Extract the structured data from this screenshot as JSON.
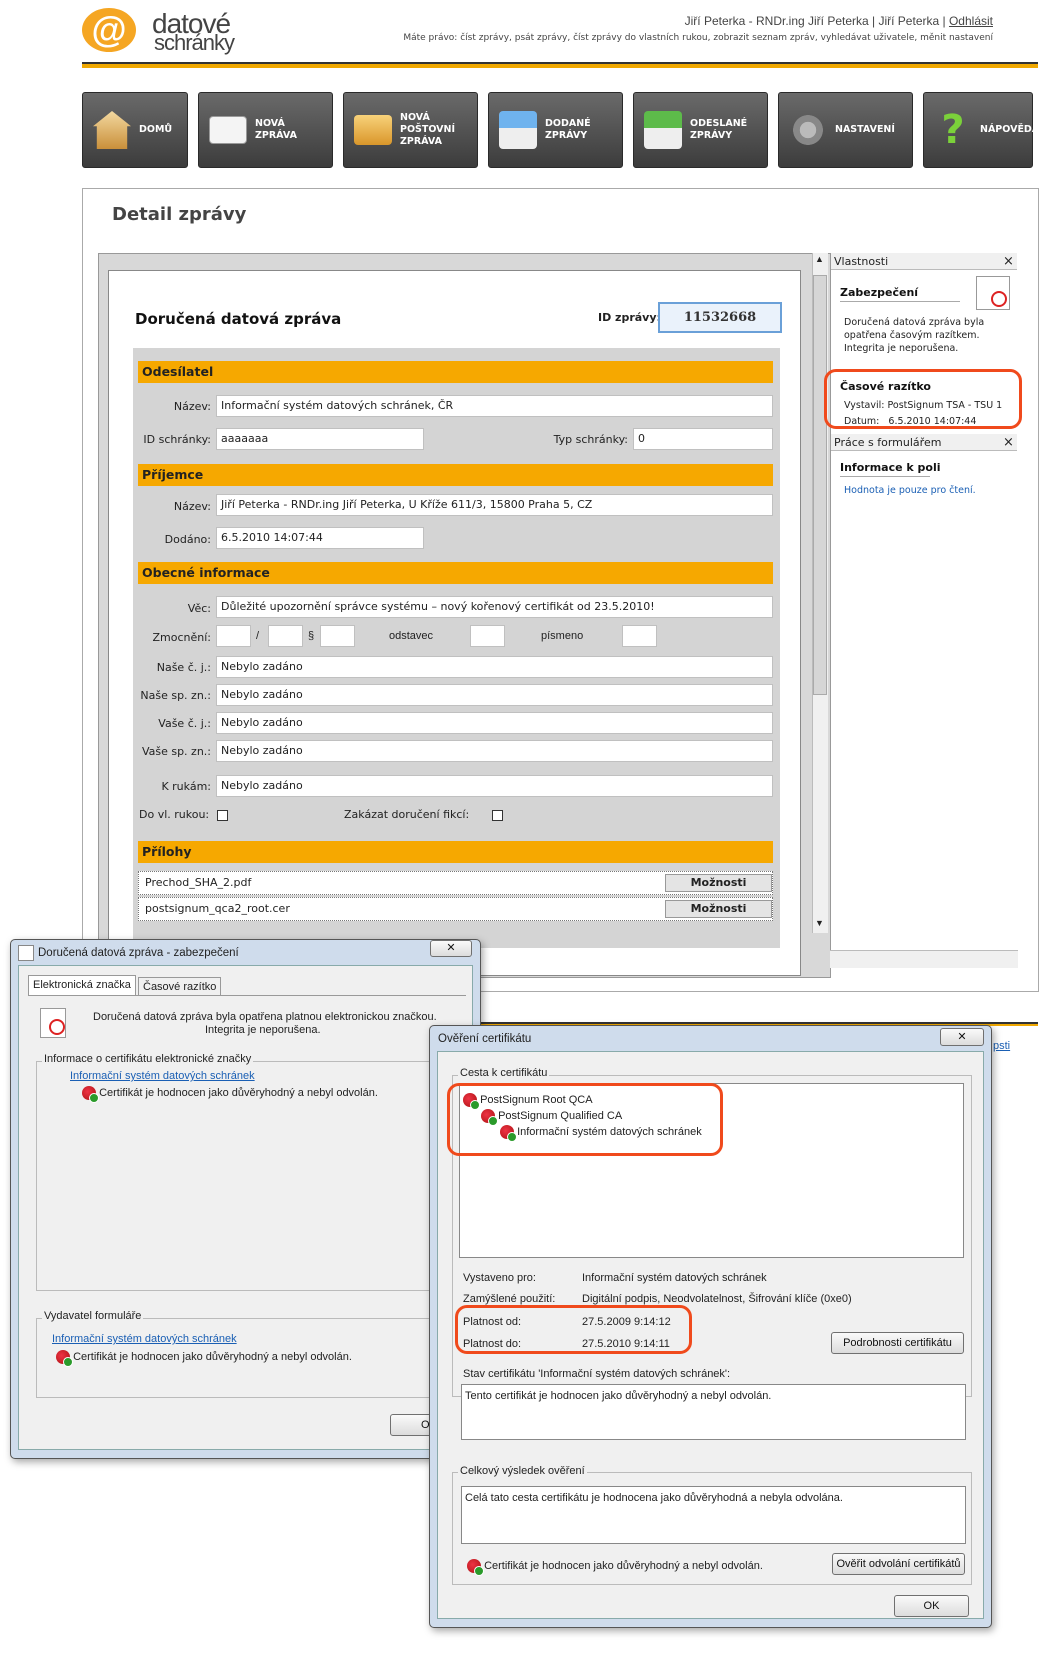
{
  "header": {
    "logo_at": "@",
    "logo_line1": "datové",
    "logo_line2": "schránky",
    "user_text": "Jiří Peterka - RNDr.ing Jiří Peterka | Jiří Peterka |",
    "logout": "Odhlásit",
    "rights": "Máte právo: číst zprávy, psát zprávy, číst zprávy do vlastních rukou, zobrazit seznam zpráv, vyhledávat uživatele, měnit nastavení"
  },
  "nav": [
    {
      "l1": "DOMŮ",
      "l2": "",
      "l3": "",
      "icon": "home-icon"
    },
    {
      "l1": "NOVÁ",
      "l2": "ZPRÁVA",
      "l3": "",
      "icon": "envelope-icon"
    },
    {
      "l1": "NOVÁ",
      "l2": "POŠTOVNÍ",
      "l3": "ZPRÁVA",
      "icon": "money-envelope-icon"
    },
    {
      "l1": "DODANÉ",
      "l2": "ZPRÁVY",
      "l3": "",
      "icon": "inbox-icon"
    },
    {
      "l1": "ODESLANÉ",
      "l2": "ZPRÁVY",
      "l3": "",
      "icon": "outbox-icon"
    },
    {
      "l1": "NASTAVENÍ",
      "l2": "",
      "l3": "",
      "icon": "gears-icon"
    },
    {
      "l1": "NÁPOVĚDA",
      "l2": "",
      "l3": "",
      "icon": "question-icon"
    }
  ],
  "page_title": "Detail zprávy",
  "message": {
    "title": "Doručená datová zpráva",
    "id_label": "ID zprávy:",
    "id_value": "11532668",
    "sections": {
      "sender": "Odesílatel",
      "recipient": "Příjemce",
      "general": "Obecné informace",
      "attachments": "Přílohy"
    },
    "sender": {
      "name_label": "Název:",
      "name_value": "Informační systém datových schránek, ČR",
      "box_label": "ID schránky:",
      "box_value": "aaaaaaa",
      "type_label": "Typ schránky:",
      "type_value": "0"
    },
    "recipient": {
      "name_label": "Název:",
      "name_value": "Jiří Peterka - RNDr.ing Jiří Peterka, U Kříže 611/3, 15800 Praha 5, CZ",
      "delivered_label": "Dodáno:",
      "delivered_value": "6.5.2010 14:07:44"
    },
    "general": {
      "subject_label": "Věc:",
      "subject_value": "Důležité upozornění správce systému – nový kořenový certifikát od 23.5.2010!",
      "auth_label": "Zmocnění:",
      "slash": "/",
      "paragraph": "§",
      "odstavec": "odstavec",
      "pismeno": "písmeno",
      "our_ref_label": "Naše č. j.:",
      "our_ref_value": "Nebylo zadáno",
      "our_file_label": "Naše sp. zn.:",
      "our_file_value": "Nebylo zadáno",
      "your_ref_label": "Vaše č. j.:",
      "your_ref_value": "Nebylo zadáno",
      "your_file_label": "Vaše sp. zn.:",
      "your_file_value": "Nebylo zadáno",
      "to_hands_label": "K rukám:",
      "to_hands_value": "Nebylo zadáno",
      "personal_label": "Do vl. rukou:",
      "fiction_label": "Zakázat doručení fikcí:"
    },
    "attachments": [
      {
        "name": "Prechod_SHA_2.pdf",
        "button": "Možnosti"
      },
      {
        "name": "postsignum_qca2_root.cer",
        "button": "Možnosti"
      }
    ]
  },
  "right_panel": {
    "props_title": "Vlastnosti",
    "close": "×",
    "security_title": "Zabezpečení",
    "security_text": [
      "Doručená datová zpráva byla",
      "opatřena  časovým razítkem.",
      "Integrita je neporušena."
    ],
    "timestamp_title": "Časové razítko",
    "issuer_label": "Vystavil:",
    "issuer_value": "PostSignum TSA - TSU 1",
    "date_label": "Datum:",
    "date_value": "6.5.2010 14:07:44",
    "form_title": "Práce s formulářem",
    "field_info_title": "Informace k poli",
    "field_info_text": "Hodnota je pouze pro čtení."
  },
  "dialog1": {
    "title": "Doručená datová zpráva - zabezpečení",
    "close": "✕",
    "tabs": [
      "Elektronická značka",
      "Časové razítko"
    ],
    "status_line1": "Doručená datová zpráva byla opatřena platnou elektronickou značkou.",
    "status_line2": "Integrita je neporušena.",
    "cert_group": "Informace o certifikátu elektronické značky",
    "cert_link": "Informační systém datových schránek",
    "cert_status": "Certifikát je hodnocen jako důvěryhodný a nebyl odvolán.",
    "issuer_group": "Vydavatel formuláře",
    "issuer_link": "Informační systém datových schránek",
    "issuer_status": "Certifikát je hodnocen jako důvěryhodný a nebyl odvolán.",
    "ok": "Ok"
  },
  "dialog2": {
    "title": "Ověření certifikátu",
    "close": "✕",
    "path_group": "Cesta k certifikátu",
    "path": [
      "PostSignum Root QCA",
      "PostSignum Qualified CA",
      "Informační systém datových schránek"
    ],
    "issued_for_label": "Vystaveno pro:",
    "issued_for_value": "Informační systém datových schránek",
    "usage_label": "Zamýšlené použití:",
    "usage_value": "Digitální podpis, Neodvolatelnost, Šifrování klíče (0xe0)",
    "valid_from_label": "Platnost od:",
    "valid_from_value": "27.5.2009 9:14:12",
    "valid_to_label": "Platnost do:",
    "valid_to_value": "27.5.2010 9:14:11",
    "details_button": "Podrobnosti certifikátu",
    "status_label": "Stav certifikátu 'Informační systém datových schránek':",
    "status_value": "Tento certifikát je hodnocen jako důvěryhodný a nebyl odvolán.",
    "result_group": "Celkový výsledek ověření",
    "result_value": "Celá tato cesta certifikátu je hodnocena jako důvěryhodná a nebyla odvolána.",
    "result_status": "Certifikát je hodnocen jako důvěryhodný a nebyl odvolán.",
    "revocation_button": "Ověřit odvolání certifikátů",
    "ok": "OK",
    "behind_link": "psti"
  }
}
